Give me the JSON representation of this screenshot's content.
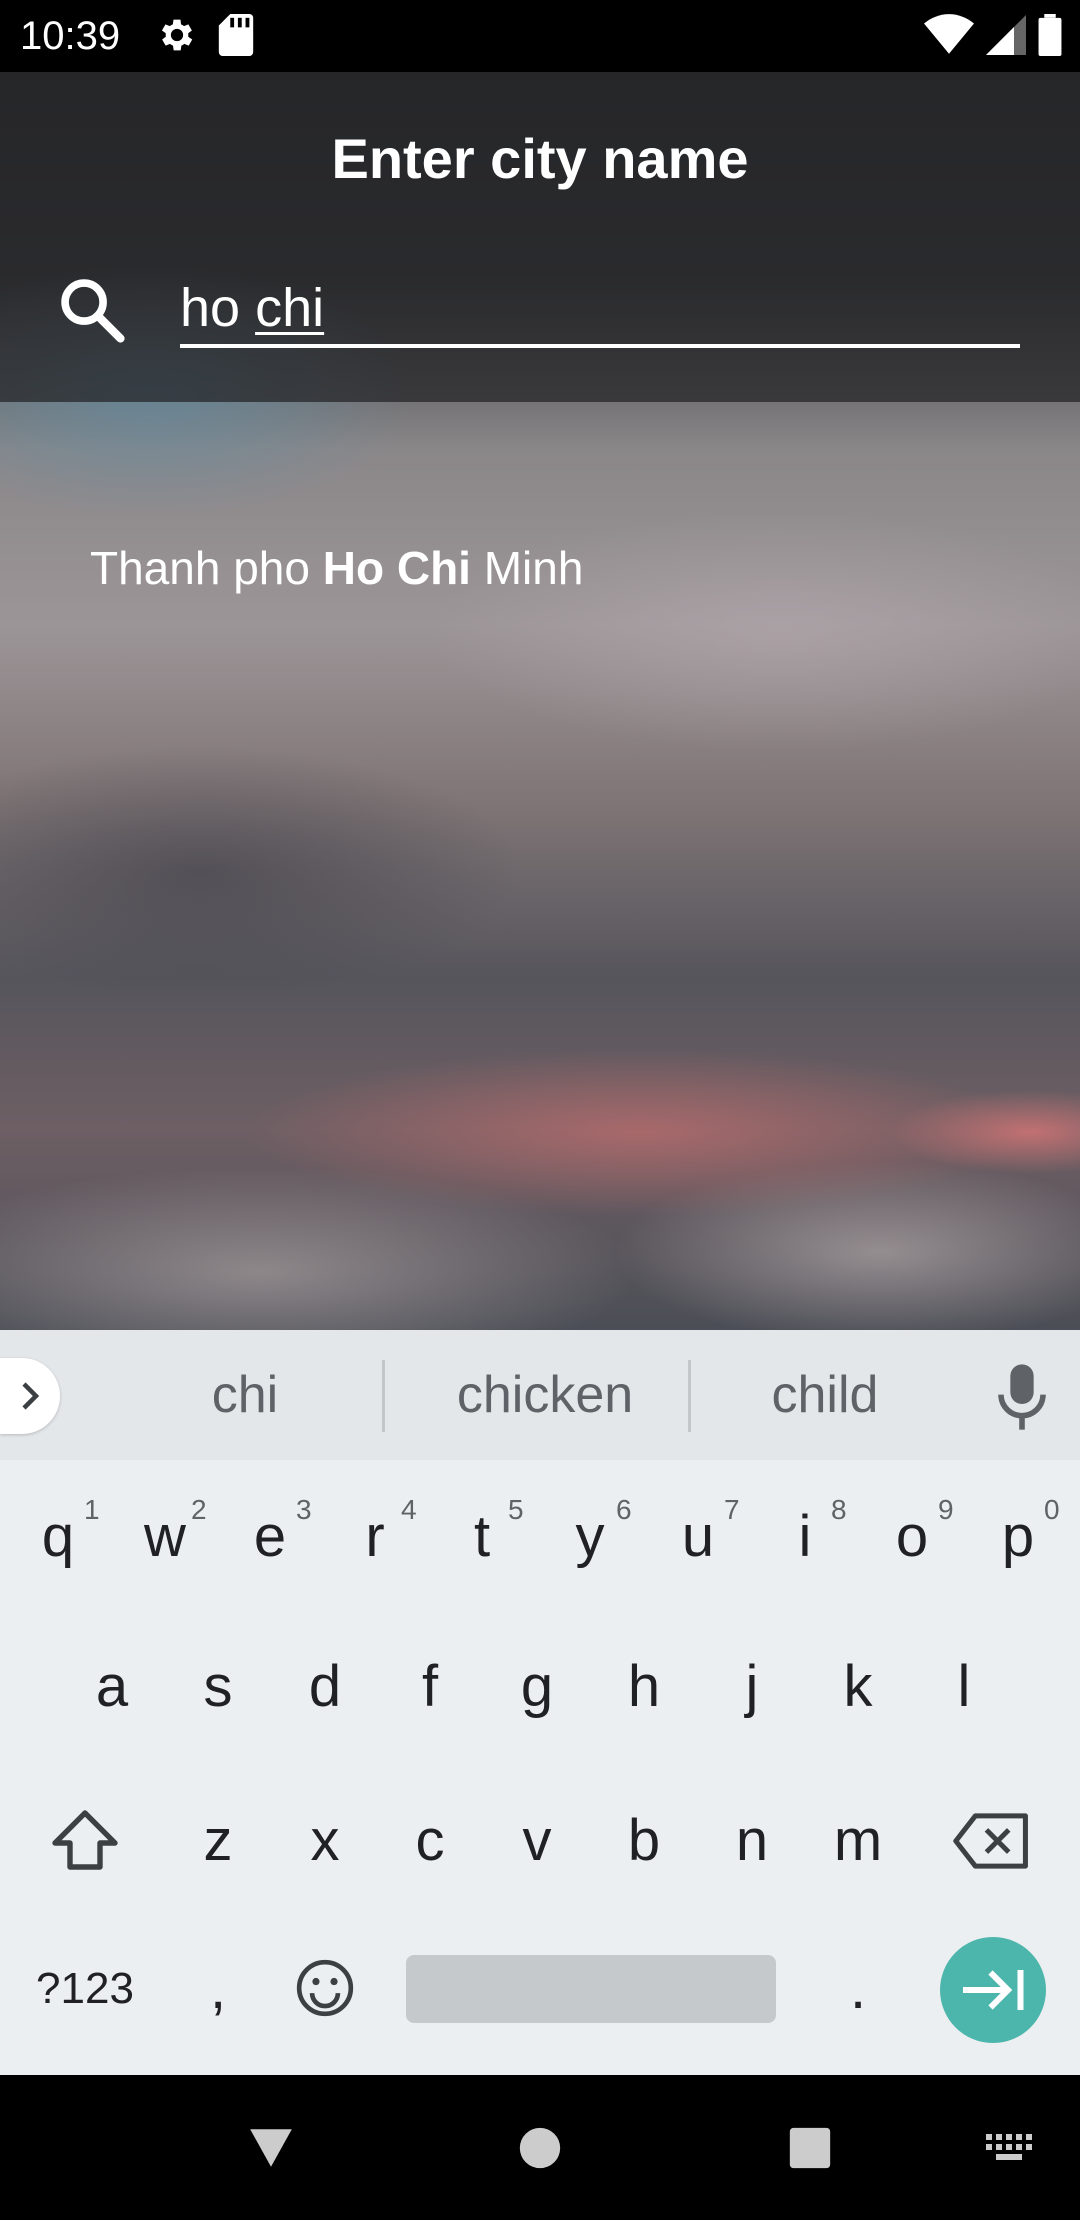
{
  "status_bar": {
    "time": "10:39",
    "icons": [
      "settings-icon",
      "sd-card-icon",
      "wifi-icon",
      "signal-icon",
      "battery-icon"
    ]
  },
  "header": {
    "title": "Enter city name",
    "search": {
      "value": "ho chi",
      "typed_prefix": "ho ",
      "composing_word": "chi"
    }
  },
  "results": [
    {
      "before": "Thanh pho ",
      "match": "Ho Chi",
      "after": " Minh"
    }
  ],
  "keyboard": {
    "suggestions": [
      "chi",
      "chicken",
      "child"
    ],
    "row1": [
      {
        "key": "q",
        "hint": "1"
      },
      {
        "key": "w",
        "hint": "2"
      },
      {
        "key": "e",
        "hint": "3"
      },
      {
        "key": "r",
        "hint": "4"
      },
      {
        "key": "t",
        "hint": "5"
      },
      {
        "key": "y",
        "hint": "6"
      },
      {
        "key": "u",
        "hint": "7"
      },
      {
        "key": "i",
        "hint": "8"
      },
      {
        "key": "o",
        "hint": "9"
      },
      {
        "key": "p",
        "hint": "0"
      }
    ],
    "row2": [
      "a",
      "s",
      "d",
      "f",
      "g",
      "h",
      "j",
      "k",
      "l"
    ],
    "row3": [
      "z",
      "x",
      "c",
      "v",
      "b",
      "n",
      "m"
    ],
    "symbols_key": "?123",
    "comma_key": ",",
    "period_key": ".",
    "accent_color": "#4db6ac"
  },
  "nav_bar": {
    "icons": [
      "back-icon",
      "home-icon",
      "recents-icon",
      "keyboard-switch-icon"
    ]
  }
}
